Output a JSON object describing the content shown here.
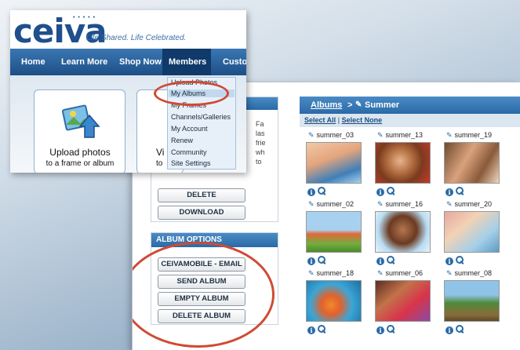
{
  "site": {
    "logo": "ceiva",
    "tagline": "Life Shared.  Life Celebrated.",
    "nav": [
      "Home",
      "Learn More",
      "Shop Now",
      "Members",
      "Custom"
    ],
    "members_menu": [
      "Upload Photos",
      "My Albums",
      "My Frames",
      "Channels/Galleries",
      "My Account",
      "Renew",
      "Community",
      "Site Settings"
    ],
    "cards": [
      {
        "title": "Upload photos",
        "subtitle": "to a frame or album"
      },
      {
        "title": "Vi",
        "subtitle": "to"
      }
    ]
  },
  "left": {
    "photo_buttons": [
      "DELETE",
      "DOWNLOAD"
    ],
    "album_options_header": "ALBUM OPTIONS",
    "album_buttons": [
      "CEIVAMOBILE - EMAIL",
      "SEND ALBUM",
      "EMPTY ALBUM",
      "DELETE ALBUM"
    ],
    "page_text": [
      "Fa",
      "las",
      "frie",
      "wh",
      "to"
    ]
  },
  "album": {
    "breadcrumb": "Albums",
    "separator": ">",
    "title": "Summer",
    "select_all": "Select All",
    "divider": "|",
    "select_none": "Select None",
    "photos": [
      {
        "name": "summer_03",
        "img": "img-a"
      },
      {
        "name": "summer_13",
        "img": "img-b"
      },
      {
        "name": "summer_19",
        "img": "img-c"
      },
      {
        "name": "summer_02",
        "img": "img-d"
      },
      {
        "name": "summer_16",
        "img": "img-e"
      },
      {
        "name": "summer_20",
        "img": "img-f"
      },
      {
        "name": "summer_18",
        "img": "img-g"
      },
      {
        "name": "summer_06",
        "img": "img-h"
      },
      {
        "name": "summer_08",
        "img": "img-i"
      }
    ]
  },
  "colors": {
    "brand": "#1f4f8c",
    "header": "#2a6aa6",
    "highlight_ring": "#cf4a34"
  }
}
